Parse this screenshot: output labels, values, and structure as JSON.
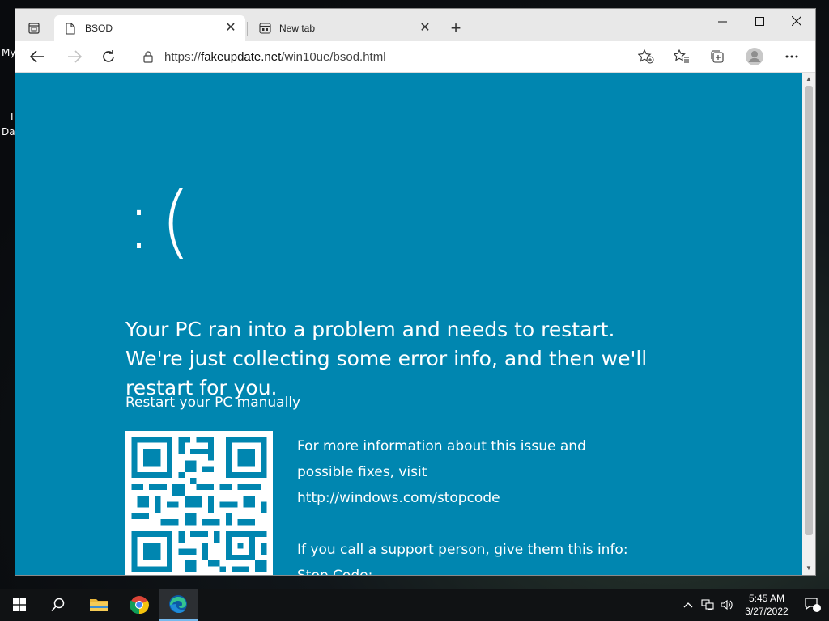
{
  "desktop": {
    "label_1": "My",
    "label_2": "I",
    "label_3": "Da"
  },
  "browser": {
    "tabs": [
      {
        "title": "BSOD",
        "icon": "document-icon",
        "active": true
      },
      {
        "title": "New tab",
        "icon": "new-tab-page-icon",
        "active": false
      }
    ],
    "close_symbol": "✕",
    "new_tab_symbol": "+",
    "window_controls": {
      "minimize": "—",
      "maximize": "☐",
      "close": "✕"
    },
    "address": {
      "scheme": "https://",
      "host": "fakeupdate.net",
      "path": "/win10ue/bsod.html"
    }
  },
  "page": {
    "background": "#0086b0",
    "sad_face": ":(",
    "headline": "Your PC ran into a problem and needs to restart. We're just collecting some error info, and then we'll restart for you.",
    "restart_manually": "Restart your PC manually",
    "info_line_1": "For more information about this issue and",
    "info_line_2": "possible fixes, visit",
    "info_line_3": "http://windows.com/stopcode",
    "support_line": "If you call a support person, give them this info:",
    "stop_code": "Stop Code: SYS_EXCEPTION_PONIES_NOT_HANDLED"
  },
  "taskbar": {
    "pinned": [
      "windows-start-icon",
      "search-icon",
      "file-explorer-icon",
      "chrome-icon",
      "edge-icon"
    ],
    "active_app": "edge-icon",
    "clock_time": "5:45 AM",
    "clock_date": "3/27/2022",
    "notification_count": "1"
  }
}
